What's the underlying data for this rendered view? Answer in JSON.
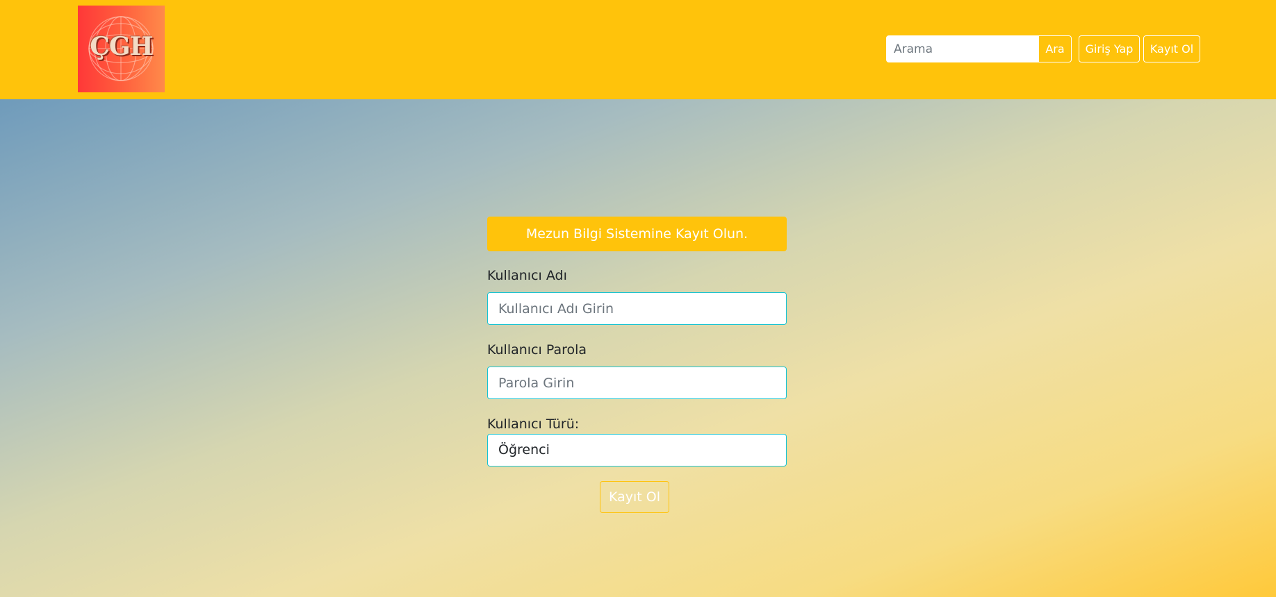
{
  "header": {
    "logo_text": "ÇGH",
    "search": {
      "placeholder": "Arama",
      "value": ""
    },
    "search_button": "Ara",
    "login_button": "Giriş Yap",
    "register_button": "Kayıt Ol"
  },
  "form": {
    "title": "Mezun Bilgi Sistemine Kayıt Olun.",
    "username_label": "Kullanıcı Adı",
    "username_placeholder": "Kullanıcı Adı Girin",
    "password_label": "Kullanıcı Parola",
    "password_placeholder": "Parola Girin",
    "type_label": "Kullanıcı Türü:",
    "type_value": "Öğrenci",
    "submit_label": "Kayıt Ol"
  },
  "colors": {
    "navbar": "#ffc30b",
    "field_border": "#17c3d2",
    "logo_red": "#ff3838"
  }
}
